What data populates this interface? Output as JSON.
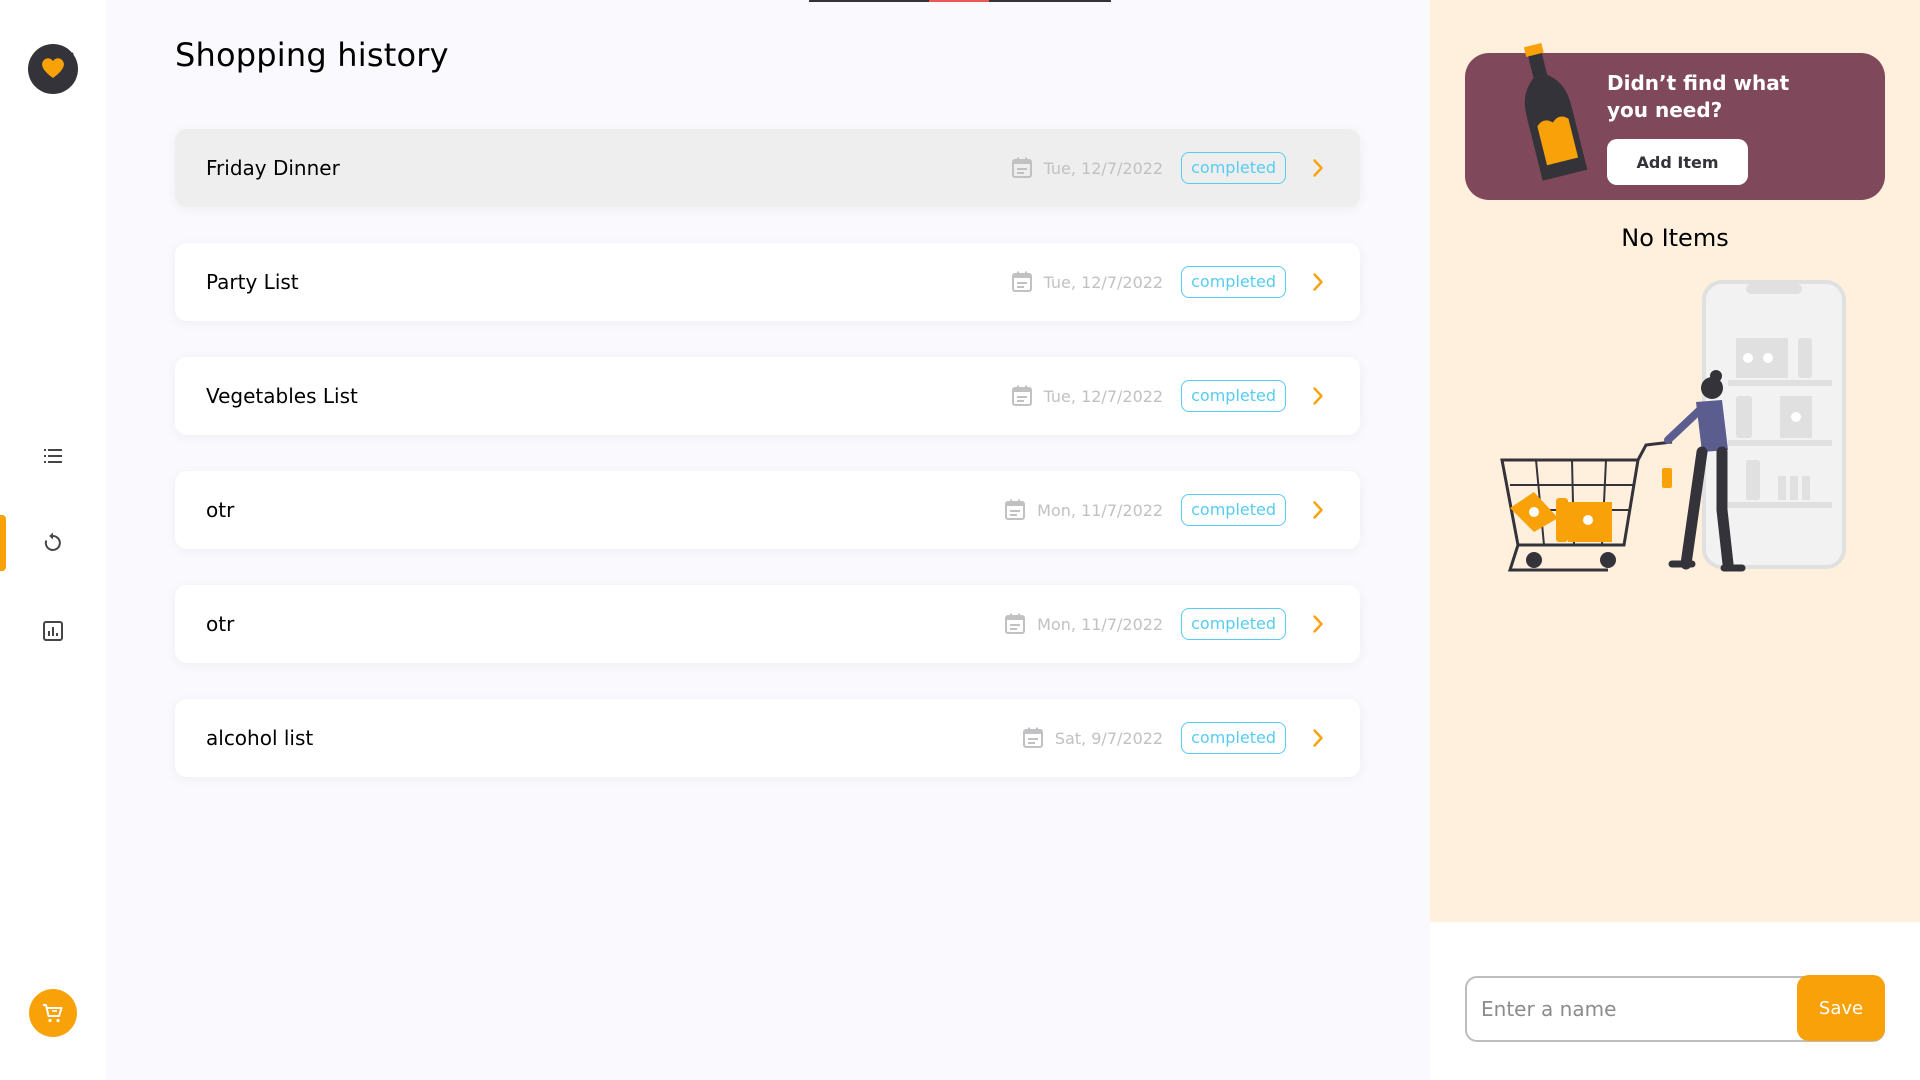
{
  "page": {
    "title": "Shopping history"
  },
  "sidebar": {
    "logo": "shoppingify-logo",
    "items": [
      {
        "name": "items",
        "icon": "list-icon"
      },
      {
        "name": "history",
        "icon": "history-icon",
        "active": true
      },
      {
        "name": "statistics",
        "icon": "bar-chart-icon"
      }
    ],
    "cart": {
      "icon": "cart-icon"
    }
  },
  "history": [
    {
      "name": "Friday Dinner",
      "date": "Tue, 12/7/2022",
      "status": "completed"
    },
    {
      "name": "Party List",
      "date": "Tue, 12/7/2022",
      "status": "completed"
    },
    {
      "name": "Vegetables List",
      "date": "Tue, 12/7/2022",
      "status": "completed"
    },
    {
      "name": "otr",
      "date": "Mon, 11/7/2022",
      "status": "completed"
    },
    {
      "name": "otr",
      "date": "Mon, 11/7/2022",
      "status": "completed"
    },
    {
      "name": "alcohol list",
      "date": "Sat, 9/7/2022",
      "status": "completed"
    }
  ],
  "right_panel": {
    "promo_text": "Didn’t find what you need?",
    "add_item_label": "Add Item",
    "empty_text": "No Items",
    "input_placeholder": "Enter a name",
    "save_label": "Save"
  },
  "colors": {
    "accent": "#f9a109",
    "promo_bg": "#80485b",
    "panel_bg": "#fff0de",
    "status": "#56ccf2"
  }
}
